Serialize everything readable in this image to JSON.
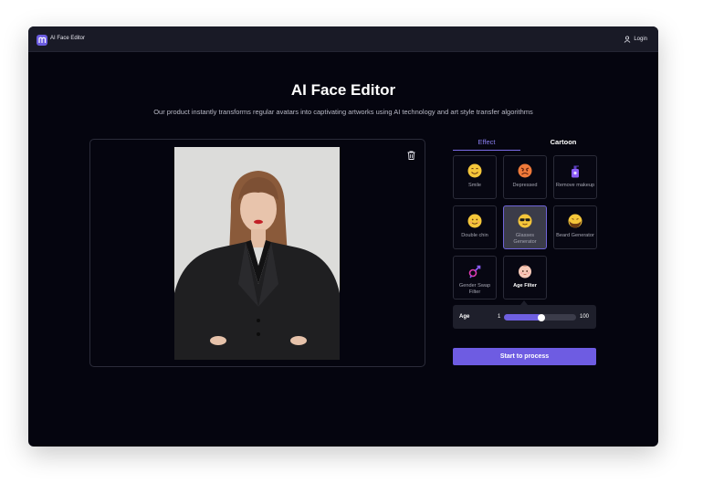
{
  "header": {
    "logo_text": "AI Face Editor",
    "login_label": "Login"
  },
  "hero": {
    "title": "AI Face Editor",
    "subtitle": "Our product instantly transforms regular avatars into captivating artworks using AI technology and art style transfer algorithms"
  },
  "tabs": [
    {
      "label": "Effect",
      "active": true
    },
    {
      "label": "Cartoon",
      "active": false
    }
  ],
  "effects": [
    {
      "label": "Smile",
      "icon": "smile-emoji-icon"
    },
    {
      "label": "Depressed",
      "icon": "angry-emoji-icon"
    },
    {
      "label": "Remove makeup",
      "icon": "cleanser-bottle-icon"
    },
    {
      "label": "Double chin",
      "icon": "smiling-face-icon"
    },
    {
      "label": "Glasses Generator",
      "icon": "sunglasses-emoji-icon",
      "selected": true
    },
    {
      "label": "Beard Generator",
      "icon": "bearded-face-icon"
    },
    {
      "label": "Gender Swap Filter",
      "icon": "gender-swap-icon"
    },
    {
      "label": "Age Filter",
      "icon": "baby-face-icon"
    }
  ],
  "age_filter": {
    "label": "Age",
    "min": "1",
    "max": "100",
    "value": 52
  },
  "process_button": "Start to process",
  "colors": {
    "accent": "#6e5ce2",
    "background": "#05050f",
    "topbar": "#191a26"
  }
}
